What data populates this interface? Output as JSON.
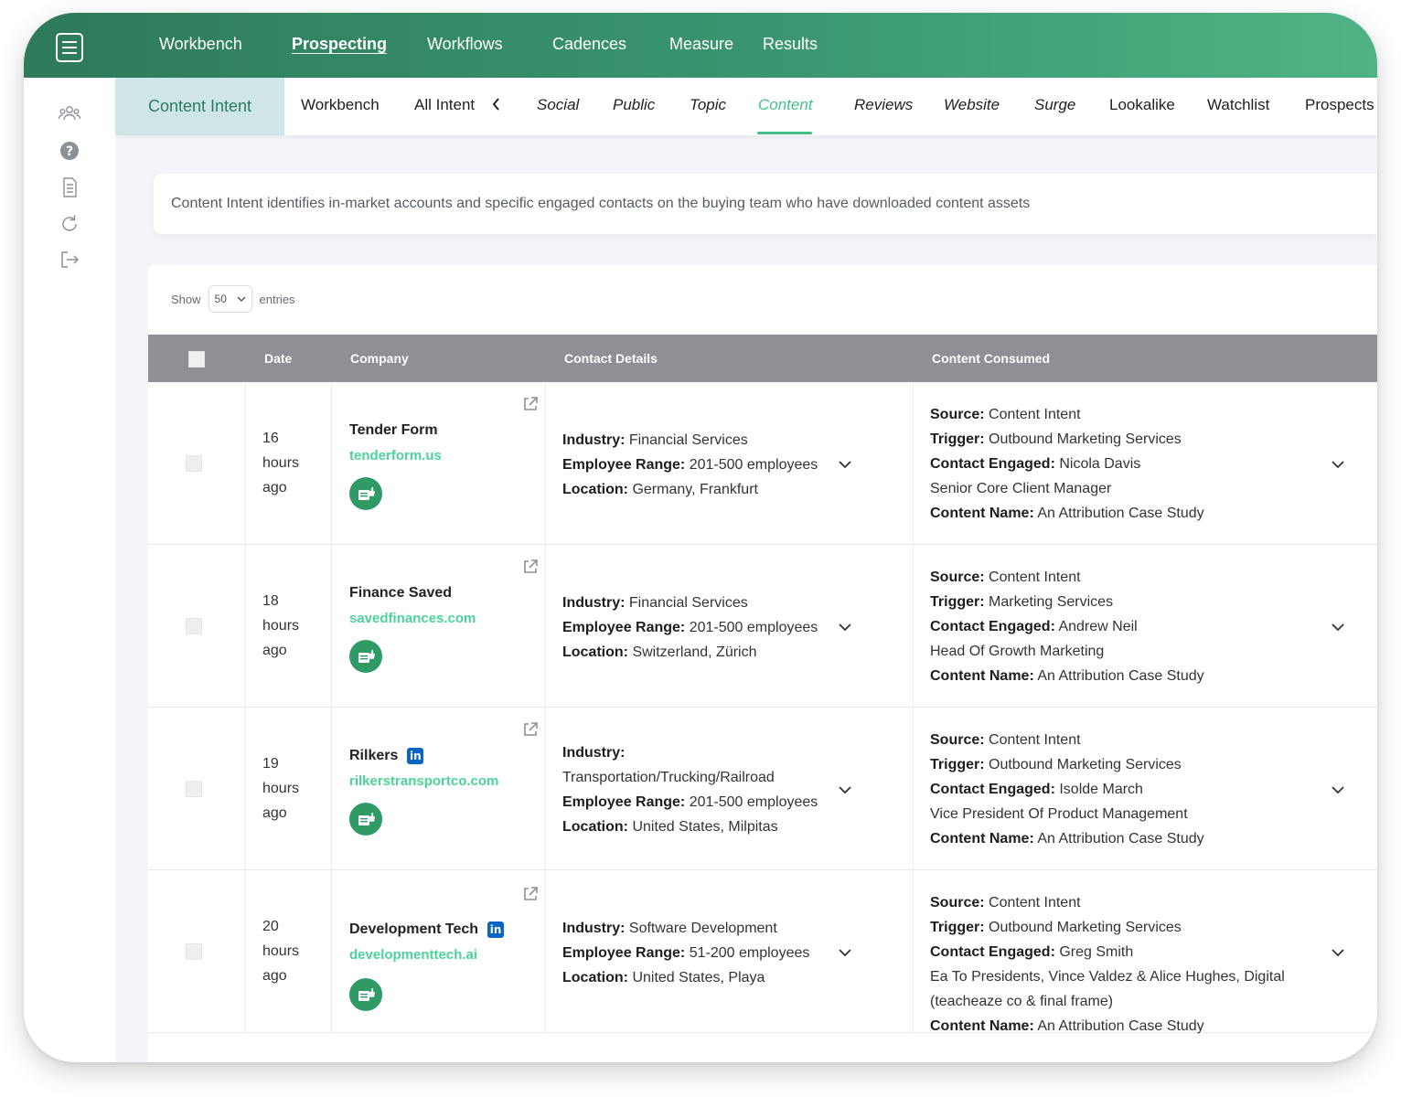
{
  "topnav": {
    "items": [
      "Workbench",
      "Prospecting",
      "Workflows",
      "Cadences",
      "Measure",
      "Results"
    ],
    "active": "Prospecting"
  },
  "sidebar": {
    "icons": [
      "users-icon",
      "help-icon",
      "document-icon",
      "refresh-icon",
      "logout-icon"
    ]
  },
  "subnav": {
    "current": "Content Intent",
    "items": [
      "Workbench",
      "All Intent",
      "Social",
      "Public",
      "Topic",
      "Content",
      "Reviews",
      "Website",
      "Surge",
      "Lookalike",
      "Watchlist",
      "Prospects"
    ],
    "active": "Content"
  },
  "description": "Content Intent identifies in-market accounts and specific engaged contacts on the buying team who have downloaded content assets",
  "table": {
    "show_label": "Show",
    "entries_value": "50",
    "entries_label": "entries",
    "headers": {
      "date": "Date",
      "company": "Company",
      "contact": "Contact Details",
      "content": "Content Consumed"
    },
    "labels": {
      "industry": "Industry:",
      "employee_range": "Employee Range:",
      "location": "Location:",
      "source": "Source:",
      "trigger": "Trigger:",
      "contact_engaged": "Contact Engaged:",
      "content_name": "Content Name:"
    },
    "rows": [
      {
        "date": [
          "16",
          "hours",
          "ago"
        ],
        "company": "Tender Form",
        "url": "tenderform.us",
        "industry": "Financial Services",
        "employee_range": "201-500 employees",
        "location": "Germany, Frankfurt",
        "source": "Content Intent",
        "trigger": "Outbound Marketing Services",
        "contact": "Nicola Davis",
        "contact_title": "Senior Core Client Manager",
        "content_name": "An Attribution Case Study"
      },
      {
        "date": [
          "18",
          "hours",
          "ago"
        ],
        "company": "Finance Saved",
        "url": "savedfinances.com",
        "industry": "Financial Services",
        "employee_range": "201-500 employees",
        "location": "Switzerland, Zürich",
        "source": "Content Intent",
        "trigger": "Marketing Services",
        "contact": "Andrew Neil",
        "contact_title": "Head Of Growth Marketing",
        "content_name": "An Attribution Case Study"
      },
      {
        "date": [
          "19",
          "hours",
          "ago"
        ],
        "company": "Rilkers",
        "url": "rilkerstransportco.com",
        "industry": "Transportation/Trucking/Railroad",
        "employee_range": "201-500 employees",
        "location": "United States, Milpitas",
        "source": "Content Intent",
        "trigger": "Outbound Marketing Services",
        "contact": "Isolde March",
        "contact_title": "Vice President Of Product Management",
        "content_name": "An Attribution Case Study"
      },
      {
        "date": [
          "20",
          "hours",
          "ago"
        ],
        "company": "Development Tech",
        "url": "developmenttech.ai",
        "industry": "Software Development",
        "employee_range": "51-200 employees",
        "location": "United States, Playa",
        "source": "Content Intent",
        "trigger": "Outbound Marketing Services",
        "contact": "Greg Smith",
        "contact_title": "Ea To Presidents, Vince Valdez & Alice Hughes, Digital (teacheaze co & final frame)",
        "content_name": "An Attribution Case Study"
      }
    ]
  },
  "colors": {
    "brand_green": "#3a9670",
    "accent": "#45c08a",
    "header_gray": "#8f9096"
  }
}
